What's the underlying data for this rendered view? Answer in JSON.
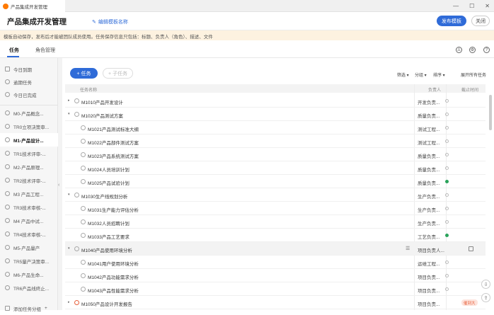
{
  "window": {
    "tab_title": "产品集成开发管理",
    "minimize": "—",
    "maximize": "☐",
    "close": "✕"
  },
  "header": {
    "title": "产品集成开发管理",
    "edit_label": "编辑模板名称",
    "publish_label": "发布模板",
    "close_label": "关闭"
  },
  "notice": "模板自动保存，发布后才能被团队成员使用。任务保存信息只包括：标题、负责人（角色）、描述、文件",
  "tabs": [
    {
      "label": "任务"
    },
    {
      "label": "角色管理"
    }
  ],
  "sidebar": {
    "fixed": [
      {
        "label": "今日到期"
      },
      {
        "label": "逾期任务"
      },
      {
        "label": "今日已完成"
      }
    ],
    "items": [
      {
        "label": "M0-产品概念..."
      },
      {
        "label": "TR0立项决策审..."
      },
      {
        "label": "M1-产品设计..."
      },
      {
        "label": "TR1技术评审-..."
      },
      {
        "label": "M2-产品原理..."
      },
      {
        "label": "TR2技术评审-..."
      },
      {
        "label": "M3 产品工程..."
      },
      {
        "label": "TR3技术审核-..."
      },
      {
        "label": "M4 产品中试..."
      },
      {
        "label": "TR4技术审核-..."
      },
      {
        "label": "M5-产品量产"
      },
      {
        "label": "TR5量产决策审..."
      },
      {
        "label": "M6-产品生命..."
      },
      {
        "label": "TR6产品线终止..."
      },
      {
        "label": "添加任务分组"
      }
    ]
  },
  "toolbar": {
    "add_task": "+ 任务",
    "add_subtask": "+ 子任务",
    "filter": "筛选 ▾",
    "group": "分组 ▾",
    "sort": "排序 ▾",
    "expand": "展开所有任务"
  },
  "table": {
    "headers": {
      "name": "任务名称",
      "owner": "负责人",
      "status": "截止时间"
    },
    "rows": [
      {
        "name": "M1010产品开发设计",
        "owner": "开发负责...",
        "level": 0,
        "arrow": "▸",
        "status": "empty"
      },
      {
        "name": "M1020产品测试方案",
        "owner": "质量负责...",
        "level": 0,
        "arrow": "▾",
        "status": "empty"
      },
      {
        "name": "M1021产品测试标准大纲",
        "owner": "测试工程...",
        "level": 1,
        "status": "empty"
      },
      {
        "name": "M1022产品部件测试方案",
        "owner": "测试工程...",
        "level": 1,
        "status": "empty"
      },
      {
        "name": "M1023产品系统测试方案",
        "owner": "质量负责...",
        "level": 1,
        "status": "empty"
      },
      {
        "name": "M1024人员培训计划",
        "owner": "质量负责...",
        "level": 1,
        "status": "empty"
      },
      {
        "name": "M1025产品试验计划",
        "owner": "质量负责...",
        "level": 1,
        "status": "green"
      },
      {
        "name": "M1030生产线规划分析",
        "owner": "生产负责...",
        "level": 0,
        "arrow": "▾",
        "status": "empty"
      },
      {
        "name": "M1031生产能力评估分析",
        "owner": "生产负责...",
        "level": 1,
        "status": "empty"
      },
      {
        "name": "M1032人员招聘计划",
        "owner": "生产负责...",
        "level": 1,
        "status": "empty"
      },
      {
        "name": "M1033产品工艺要求",
        "owner": "工艺负责...",
        "level": 1,
        "status": "green"
      },
      {
        "name": "M1040产品使用环境分析",
        "owner": "项目负责人...",
        "level": 0,
        "arrow": "▾",
        "status": "checkbox"
      },
      {
        "name": "M1041用户使用环境分析",
        "owner": "运维工程...",
        "level": 1,
        "status": "empty"
      },
      {
        "name": "M1042产品功能需求分析",
        "owner": "项目负责...",
        "level": 1,
        "status": "empty"
      },
      {
        "name": "M1043产品性能需求分析",
        "owner": "项目负责...",
        "level": 1,
        "status": "empty"
      },
      {
        "name": "M1050产品设计开发报告",
        "owner": "项目负责...",
        "level": 0,
        "arrow": "▸",
        "status": "badge",
        "badge": "催到大"
      }
    ]
  },
  "colors": {
    "accent": "#2f6bd8",
    "notice_bg": "#fdf2e0",
    "badge": "#e8613c",
    "done": "#2aa35b"
  }
}
